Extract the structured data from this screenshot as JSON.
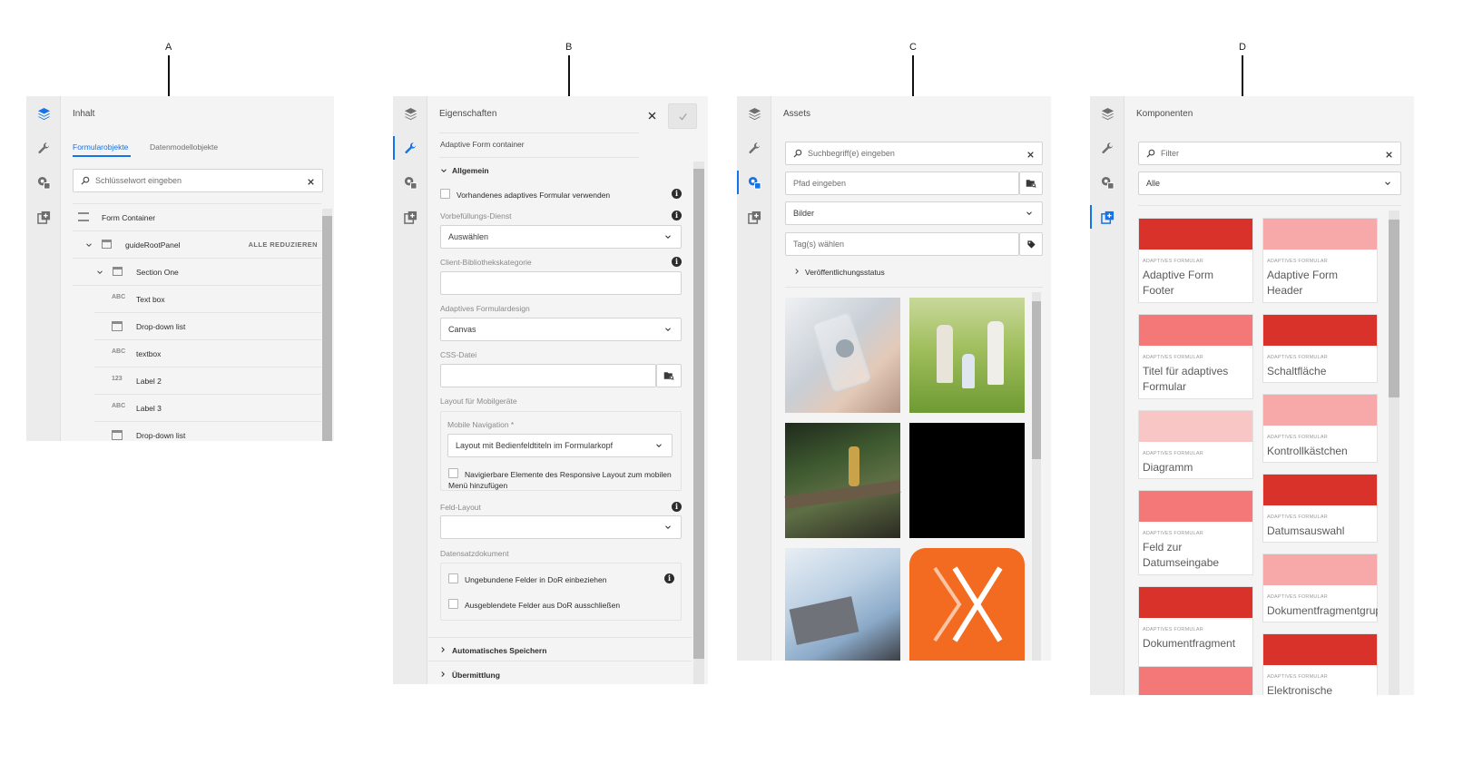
{
  "callouts": [
    "A",
    "B",
    "C",
    "D"
  ],
  "colors": {
    "accent": "#1473e6",
    "swatch_red": "#d9322a",
    "swatch_salmon": "#f47878",
    "swatch_pink": "#f7a9a9",
    "swatch_lightpink": "#f9c6c6",
    "asset_orange": "#f26b20"
  },
  "rail_icons": [
    "layers-icon",
    "wrench-icon",
    "assets-icon",
    "components-icon"
  ],
  "panelA": {
    "title": "Inhalt",
    "tabs": [
      "Formularobjekte",
      "Datenmodellobjekte"
    ],
    "search_placeholder": "Schlüsselwort eingeben",
    "collapse_all": "ALLE REDUZIEREN",
    "tree": [
      {
        "icon": "form-icon",
        "type_label": "",
        "label": "Form Container"
      },
      {
        "icon": "panel-icon",
        "type_label": "",
        "label": "guideRootPanel"
      },
      {
        "icon": "panel-icon",
        "type_label": "",
        "label": "Section One"
      },
      {
        "icon": "",
        "type_label": "ABC",
        "label": "Text box"
      },
      {
        "icon": "list-icon",
        "type_label": "",
        "label": "Drop-down list"
      },
      {
        "icon": "",
        "type_label": "ABC",
        "label": "textbox"
      },
      {
        "icon": "",
        "type_label": "123",
        "label": "Label 2"
      },
      {
        "icon": "",
        "type_label": "ABC",
        "label": "Label 3"
      },
      {
        "icon": "list-icon",
        "type_label": "",
        "label": "Drop-down list"
      }
    ]
  },
  "panelB": {
    "title": "Eigenschaften",
    "component": "Adaptive Form container",
    "section_general": "Allgemein",
    "use_existing": "Vorhandenes adaptives Formular verwenden",
    "prefill_label": "Vorbefüllungs-Dienst",
    "prefill_value": "Auswählen",
    "client_lib_label": "Client-Bibliothekskategorie",
    "design_label": "Adaptives Formulardesign",
    "design_value": "Canvas",
    "css_label": "CSS-Datei",
    "mobile_layout_label": "Layout für Mobilgeräte",
    "mobile_nav_label": "Mobile Navigation *",
    "mobile_nav_value": "Layout mit Bedienfeldtiteln im Formularkopf",
    "navigable_line1": "Navigierbare Elemente des Responsive Layout zum mobilen",
    "navigable_line2": "Menü hinzufügen",
    "field_layout_label": "Feld-Layout",
    "dor_label": "Datensatzdokument",
    "dor_unbound": "Ungebundene Felder in DoR einbeziehen",
    "dor_hidden": "Ausgeblendete Felder aus DoR ausschließen",
    "section_autosave": "Automatisches Speichern",
    "section_submit": "Übermittlung"
  },
  "panelC": {
    "title": "Assets",
    "search_placeholder": "Suchbegriff(e) eingeben",
    "path_placeholder": "Pfad eingeben",
    "type_value": "Bilder",
    "tags_placeholder": "Tag(s) wählen",
    "publish_status": "Veröffentlichungsstatus",
    "thumbnails": [
      "phone-hand-image",
      "family-walking-image",
      "hiker-forest-image",
      "black-image",
      "laptop-typing-image",
      "orange-x-logo-image"
    ]
  },
  "panelD": {
    "title": "Komponenten",
    "filter_placeholder": "Filter",
    "group_value": "Alle",
    "category": "ADAPTIVES FORMULAR",
    "cards": [
      {
        "name": "Adaptive Form Footer",
        "color": "#d9322a"
      },
      {
        "name": "Adaptive Form Header",
        "color": "#f7a9a9"
      },
      {
        "name": "Titel für adaptives Formular",
        "color": "#f47878"
      },
      {
        "name": "Schaltfläche",
        "color": "#d9322a"
      },
      {
        "name": "Diagramm",
        "color": "#f9c6c6"
      },
      {
        "name": "Kontrollkästchen",
        "color": "#f7a9a9"
      },
      {
        "name": "Feld zur Datumseingabe",
        "color": "#f47878"
      },
      {
        "name": "Datumsauswahl",
        "color": "#d9322a"
      },
      {
        "name": "Dokumentfragment",
        "color": "#d9322a"
      },
      {
        "name": "Dokumentfragmentgrup",
        "color": "#f7a9a9"
      },
      {
        "name": "",
        "color": "#f47878"
      },
      {
        "name": "Elektronische",
        "color": "#d9322a"
      }
    ]
  }
}
